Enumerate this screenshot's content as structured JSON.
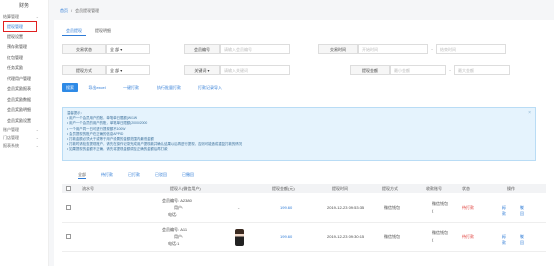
{
  "sidebar": {
    "brand": "财务",
    "group_settlement": "结算管理",
    "items": [
      "提现管理",
      "提现设置",
      "预存款管理",
      "红包管理",
      "任务奖励",
      "代理用户管理",
      "会员奖励报表",
      "会员奖励数据",
      "会员奖励明细",
      "会员奖励设置"
    ],
    "group_account": "账户管理",
    "group_shop": "门店管理",
    "group_report": "报表系统"
  },
  "breadcrumb": [
    "首页",
    "/",
    "会员提现管理"
  ],
  "tabs": [
    "会员提现",
    "提现明细"
  ],
  "filters": {
    "trade_status_label": "交易状态",
    "trade_status_value": "全 部",
    "member_no_label": "会员编号",
    "member_no_placeholder": "请输入会员编号",
    "trade_time_label": "交易时间",
    "start_placeholder": "开始时间",
    "end_placeholder": "结束时间",
    "range_sep": "-",
    "method_label": "提现方式",
    "method_value": "全 部",
    "keyword_label": "关键词",
    "keyword_placeholder": "请输入关键词",
    "amount_label": "提现金额",
    "min_placeholder": "最小金额",
    "max_placeholder": "最大金额"
  },
  "actions": {
    "search": "搜索",
    "export_excel": "导出excel",
    "one_click": "一键打款",
    "batch_pay": "执行批量打款",
    "print_import": "打款记录导入"
  },
  "notice": {
    "title": "温馨提示：",
    "lines": [
      "• 用户一个会员用户的账，单笔单日限额(W/1W",
      "• 用户一个会员的用户的账，单笔单日限额(2000/2000",
      "• 一个用户同一日可进行提现额不100W",
      "• 会员提现的账户在正确的信息APPID",
      "• 打款金额必须大于或等于用户设置的金额范围内最低金额",
      "• 打款时请检查提现账户，请先在操作记录完成用户提现款并确认结果以后再进行提现，否则可能造成重复打款的情况",
      "• 如果提现的金额不正确，请先将提现金额调至正确的金额后再打款"
    ]
  },
  "subtabs": [
    "全部",
    "待打款",
    "已打款",
    "已驳回",
    "已撤回"
  ],
  "table": {
    "columns": [
      "流水号",
      "提现人(微信用户)",
      "提现金额(元)",
      "提现时间",
      "提现方式",
      "收款账号",
      "状态",
      "操作"
    ],
    "rows": [
      {
        "member": "会员编号: A2380",
        "user": "用户:",
        "phone": "电话:",
        "amount": "199.60",
        "time": "2019-12-23 09:53:35",
        "method": "微信钱包",
        "account_line1": "微信钱包",
        "account_line2": "(",
        "status": "待打款",
        "pay": "打款",
        "reject": "驳回"
      },
      {
        "member": "会员编号: A11",
        "user": "用户:",
        "phone": "电话:1",
        "amount": "199.60",
        "time": "2019-12-23 09:30:15",
        "method": "微信钱包",
        "account_line1": "微信钱包",
        "account_line2": "(",
        "status": "待打款",
        "pay": "打款",
        "reject": "驳回"
      }
    ]
  },
  "colors": {
    "accent": "#2e7bd6",
    "primary_button": "#2e8ae6",
    "status_red": "#e0403c",
    "notice_bg": "#e5f3fd",
    "active_outline": "#e02020"
  },
  "icons": [
    "chevron-down-icon",
    "close-icon",
    "checkbox-icon",
    "print-icon",
    "reject-icon",
    "avatar-image"
  ]
}
